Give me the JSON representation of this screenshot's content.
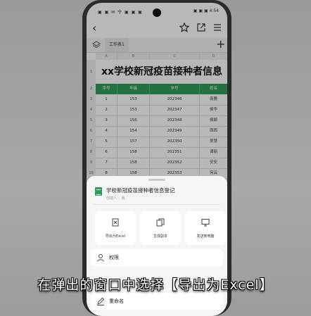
{
  "status_bar": {
    "left": "▣ ▣ ✉ 令 ▣ ▣ ▣",
    "right": "▣ ▣ ▣ 4:54"
  },
  "sheet_tab": "工作表1",
  "spreadsheet": {
    "columns": [
      "A",
      "B",
      "C",
      "D"
    ],
    "title": "xx学校新冠疫苗接种者信息",
    "header": [
      "序号",
      "年级",
      "学号",
      "姓名"
    ],
    "rows": [
      [
        "1",
        "153",
        "202346",
        "庞鹿"
      ],
      [
        "2",
        "153",
        "202347",
        "侯华"
      ],
      [
        "3",
        "156",
        "202348",
        "侯颖"
      ],
      [
        "4",
        "154",
        "202349",
        "西西"
      ],
      [
        "5",
        "157",
        "202350",
        "吴慧"
      ],
      [
        "6",
        "158",
        "202351",
        "谭丽"
      ],
      [
        "7",
        "158",
        "202352",
        "安安"
      ],
      [
        "8",
        "158",
        "202353",
        "何云"
      ]
    ],
    "row_numbers": [
      "1",
      "2",
      "3",
      "4",
      "5",
      "6",
      "7",
      "8",
      "9",
      "10"
    ]
  },
  "bottom_sheet": {
    "file_title": "学校新冠疫苗接种者信息登记",
    "file_meta": "创建人 ：我",
    "actions": [
      {
        "label": "导出为Excel",
        "icon": "excel-export-icon"
      },
      {
        "label": "生成副本",
        "icon": "copy-icon"
      },
      {
        "label": "发送到电脑",
        "icon": "monitor-icon"
      }
    ],
    "list_items": [
      {
        "label": "权限",
        "icon": "person-icon"
      },
      {
        "label": "重命名",
        "icon": "pencil-icon"
      }
    ]
  },
  "caption": "在弹出的窗口中选择【导出为Excel】",
  "colors": {
    "accent_green": "#2f9e5a",
    "sheet_bg": "#f5f5f5"
  }
}
